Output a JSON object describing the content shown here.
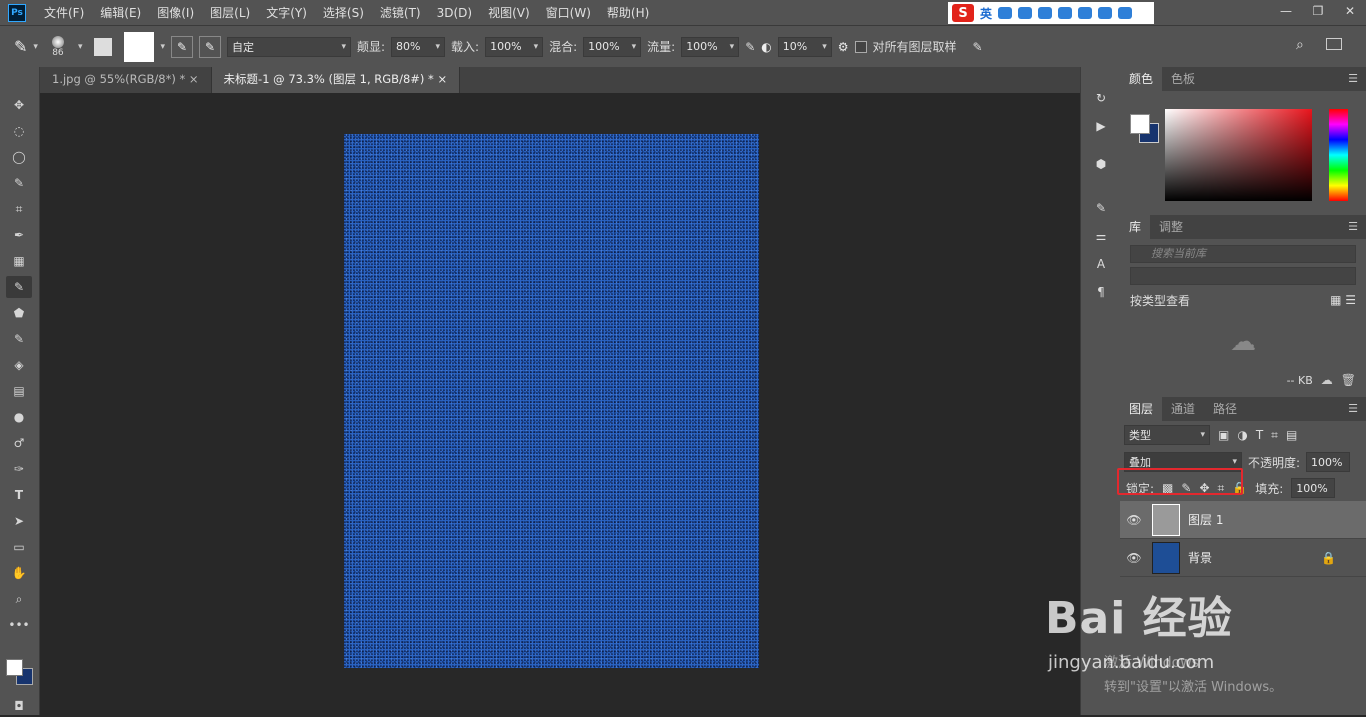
{
  "app": {
    "logo": "Ps"
  },
  "menu": [
    "文件(F)",
    "编辑(E)",
    "图像(I)",
    "图层(L)",
    "文字(Y)",
    "选择(S)",
    "滤镜(T)",
    "3D(D)",
    "视图(V)",
    "窗口(W)",
    "帮助(H)"
  ],
  "ime": {
    "logo": "S",
    "lang": "英"
  },
  "options": {
    "brush_size": "86",
    "mode": "自定",
    "opacity_label": "颠显:",
    "opacity_value": "80%",
    "flow_label": "载入:",
    "flow_value": "100%",
    "mix_label": "混合:",
    "mix_value": "100%",
    "rate_label": "流量:",
    "rate_value": "100%",
    "angle_value": "10%",
    "sample_all_label": "对所有图层取样"
  },
  "tabs": [
    {
      "label": "1.jpg @ 55%(RGB/8*) *",
      "close": "×"
    },
    {
      "label": "未标题-1 @ 73.3% (图层 1, RGB/8#) *",
      "close": "×"
    }
  ],
  "color_panel": {
    "tabs": [
      "颜色",
      "色板"
    ]
  },
  "library_panel": {
    "tabs": [
      "库",
      "调整"
    ],
    "search_placeholder": "搜索当前库",
    "view_label": "按类型查看",
    "size": "-- KB"
  },
  "layers_panel": {
    "tabs": [
      "图层",
      "通道",
      "路径"
    ],
    "filter_label": "类型",
    "blend_mode": "叠加",
    "opacity_label": "不透明度:",
    "opacity_value": "100%",
    "lock_label": "锁定:",
    "fill_label": "填充:",
    "fill_value": "100%",
    "layers": [
      {
        "name": "图层 1"
      },
      {
        "name": "背景"
      }
    ]
  },
  "colors": {
    "accent": "#31a8ff",
    "highlight": "#e3282e",
    "doc": "#2a64c4"
  },
  "watermark": {
    "brand": "Bai 经验",
    "url": "jingyan.baidu.com"
  },
  "activation": {
    "line1": "激活 Windows",
    "line2": "转到\"设置\"以激活 Windows。"
  }
}
